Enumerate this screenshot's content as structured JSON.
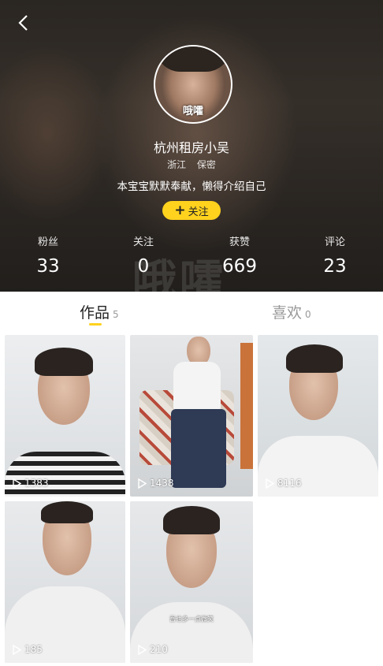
{
  "profile": {
    "name": "杭州租房小吴",
    "location": "浙江",
    "gender": "保密",
    "bio": "本宝宝默默奉献，懒得介绍自己",
    "avatar_caption": "哦嚯",
    "follow_label": "关注",
    "bg_watermark": "哦嚯"
  },
  "stats": [
    {
      "label": "粉丝",
      "value": "33"
    },
    {
      "label": "关注",
      "value": "0"
    },
    {
      "label": "获赞",
      "value": "669"
    },
    {
      "label": "评论",
      "value": "23"
    }
  ],
  "tabs": [
    {
      "label": "作品",
      "count": "5"
    },
    {
      "label": "喜欢",
      "count": "0"
    }
  ],
  "videos": [
    {
      "plays": "1383"
    },
    {
      "plays": "1438"
    },
    {
      "plays": "8116"
    },
    {
      "plays": "185"
    },
    {
      "plays": "210",
      "overlay_text": "吾也多一点微笑"
    }
  ],
  "colors": {
    "accent": "#ffd21e"
  }
}
